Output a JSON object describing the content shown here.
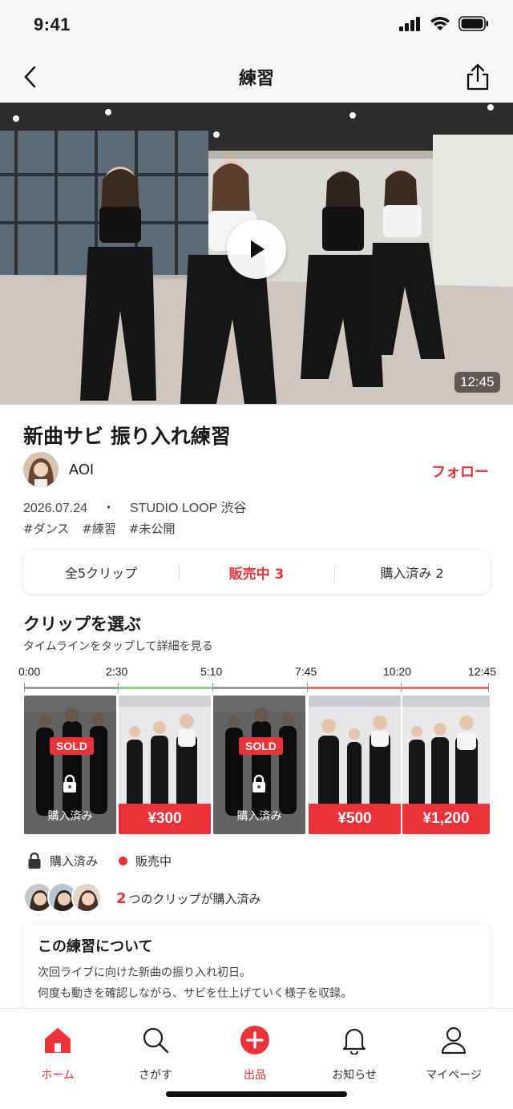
{
  "status_bar": {
    "time": "9:41"
  },
  "header": {
    "title": "練習"
  },
  "video": {
    "duration": "12:45"
  },
  "practice": {
    "title": "新曲サビ 振り入れ練習",
    "author": "AOI",
    "follow_label": "フォロー",
    "date": "2026.07.24",
    "separator": "・",
    "location": "STUDIO LOOP 渋谷",
    "tags": [
      "#ダンス",
      "#練習",
      "#未公開"
    ]
  },
  "stats": {
    "all_clips": "全5クリップ",
    "on_sale": "販売中 3",
    "purchased": "購入済み 2"
  },
  "clips_section": {
    "title": "クリップを選ぶ",
    "subtitle": "タイムラインをタップして詳細を見る",
    "ticks": [
      "0:00",
      "2:30",
      "5:10",
      "7:45",
      "10:20",
      "12:45"
    ],
    "clips": [
      {
        "status": "purchased",
        "badge": "SOLD",
        "label": "購入済み"
      },
      {
        "status": "on_sale",
        "price": "¥300"
      },
      {
        "status": "purchased",
        "badge": "SOLD",
        "label": "購入済み"
      },
      {
        "status": "on_sale",
        "price": "¥500"
      },
      {
        "status": "on_sale",
        "price": "¥1,200"
      }
    ],
    "legend": {
      "purchased": "購入済み",
      "on_sale": "販売中"
    }
  },
  "purchase_summary": {
    "count": "2",
    "text": "つのクリップが購入済み"
  },
  "about": {
    "title": "この練習について",
    "line1": "次回ライブに向けた新曲の振り入れ初日。",
    "line2": "何度も動きを確認しながら、サビを仕上げていく様子を収録。"
  },
  "tab_bar": {
    "items": [
      {
        "label": "ホーム",
        "icon": "home-icon"
      },
      {
        "label": "さがす",
        "icon": "search-icon"
      },
      {
        "label": "出品",
        "icon": "plus-circle-icon"
      },
      {
        "label": "お知らせ",
        "icon": "bell-icon"
      },
      {
        "label": "マイページ",
        "icon": "user-icon"
      }
    ]
  },
  "colors": {
    "accent": "#e8333b",
    "purchased_line": "#8fd18f",
    "timeline_gray": "#9a9a9a"
  }
}
